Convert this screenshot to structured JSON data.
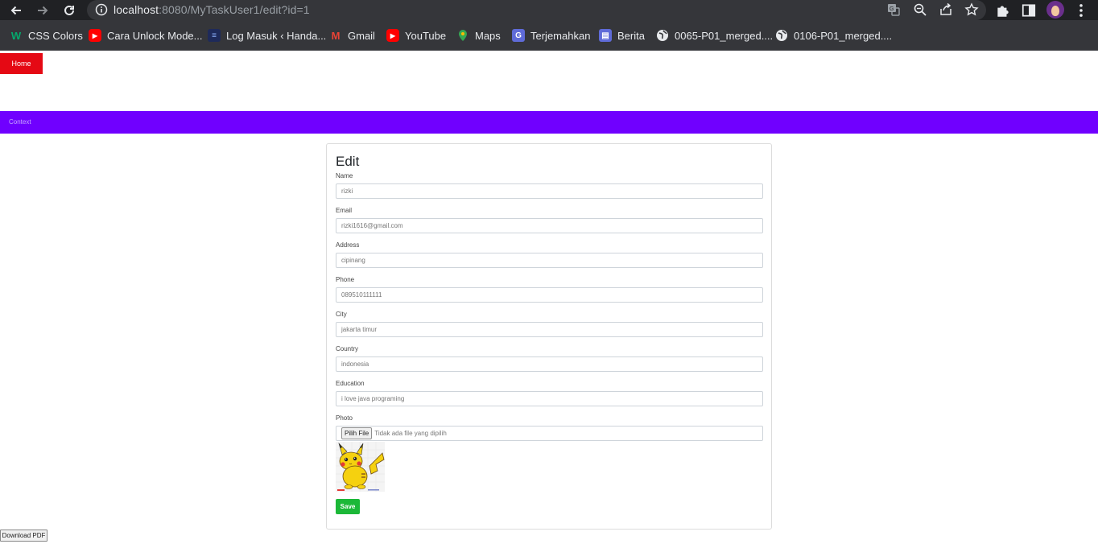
{
  "browser": {
    "url_host": "localhost",
    "url_rest": ":8080/MyTaskUser1/edit?id=1",
    "bookmarks": [
      {
        "label": "CSS Colors",
        "icon": "w3schools-icon",
        "color": "#04aa6d",
        "glyph": "W"
      },
      {
        "label": "Cara Unlock Mode...",
        "icon": "youtube-icon",
        "color": "#ff0000",
        "glyph": "▶"
      },
      {
        "label": "Log Masuk ‹ Handa...",
        "icon": "site-icon",
        "color": "#1e2a5a",
        "glyph": "≡"
      },
      {
        "label": "Gmail",
        "icon": "gmail-icon",
        "color": "#ea4335",
        "glyph": "M"
      },
      {
        "label": "YouTube",
        "icon": "youtube-icon",
        "color": "#ff0000",
        "glyph": "▶"
      },
      {
        "label": "Maps",
        "icon": "maps-icon",
        "color": "#34a853",
        "glyph": "●"
      },
      {
        "label": "Terjemahkan",
        "icon": "translate-icon",
        "color": "#5f6bd8",
        "glyph": "G"
      },
      {
        "label": "Berita",
        "icon": "news-icon",
        "color": "#5f6bd8",
        "glyph": "▤"
      },
      {
        "label": "0065-P01_merged....",
        "icon": "globe-icon",
        "color": "#e8eaed",
        "glyph": "◍"
      },
      {
        "label": "0106-P01_merged....",
        "icon": "globe-icon",
        "color": "#e8eaed",
        "glyph": "◍"
      }
    ]
  },
  "nav": {
    "home_label": "Home",
    "home_color": "#e50914",
    "context_label": "Context",
    "context_color": "#7000ff"
  },
  "form": {
    "title": "Edit",
    "fields": [
      {
        "label": "Name",
        "value": "rizki"
      },
      {
        "label": "Email",
        "value": "rizki1616@gmail.com"
      },
      {
        "label": "Address",
        "value": "cipinang"
      },
      {
        "label": "Phone",
        "value": "089510111111"
      },
      {
        "label": "City",
        "value": "jakarta timur"
      },
      {
        "label": "Country",
        "value": "indonesia"
      },
      {
        "label": "Education",
        "value": "i love java programing"
      }
    ],
    "photo_label": "Photo",
    "file_button": "Pilih File",
    "file_status": "Tidak ada file yang dipilih",
    "save_label": "Save",
    "save_color": "#1cb838"
  },
  "download_pdf_label": "Download PDF"
}
